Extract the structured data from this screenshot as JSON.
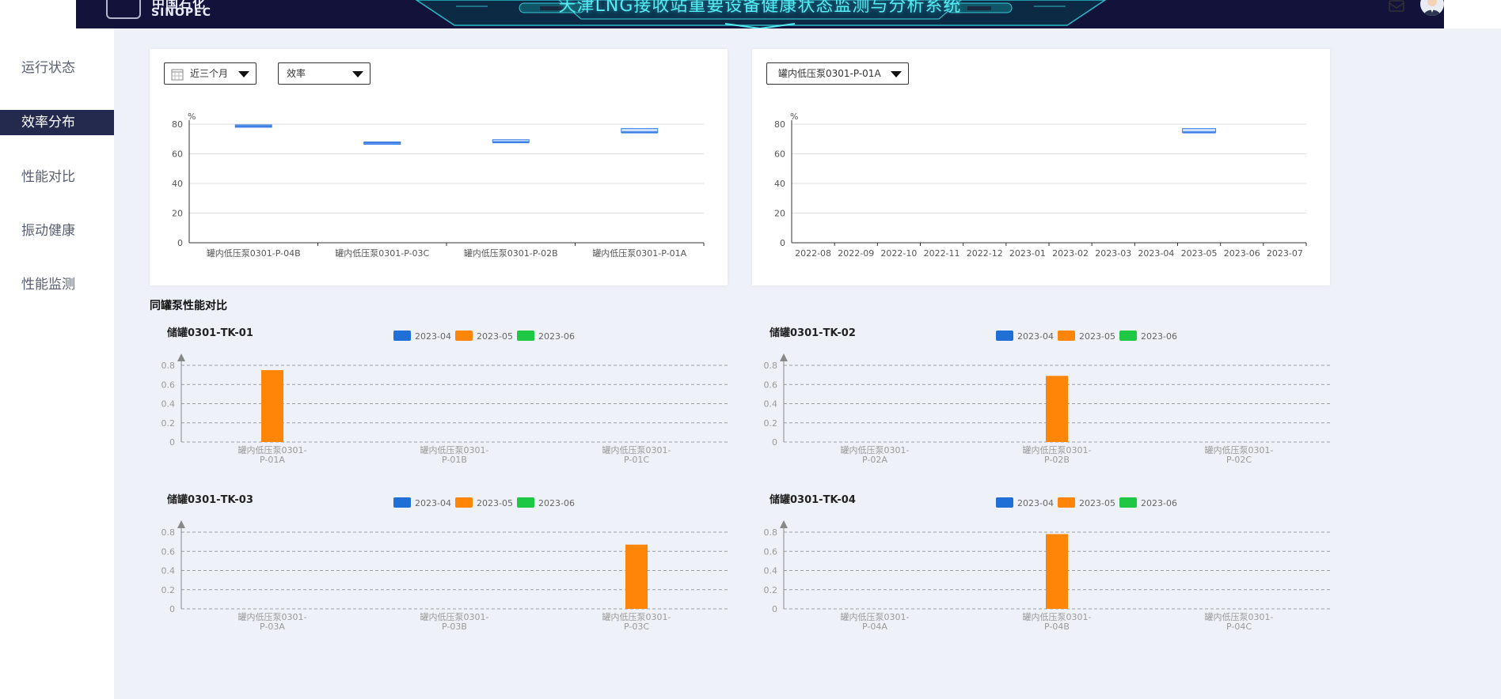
{
  "header": {
    "logo_cn": "中国石化",
    "logo_en": "SINOPEC",
    "title": "天津LNG接收站重要设备健康状态监测与分析系统",
    "accent": "#55ecf2",
    "bg": "#13123a"
  },
  "sidebar": {
    "items": [
      {
        "label": "运行状态",
        "active": false
      },
      {
        "label": "效率分布",
        "active": true
      },
      {
        "label": "性能对比",
        "active": false
      },
      {
        "label": "振动健康",
        "active": false
      },
      {
        "label": "性能监测",
        "active": false
      }
    ]
  },
  "filters": {
    "period": "近三个月",
    "metric": "效率",
    "pump": "罐内低压泵0301-P-01A"
  },
  "section": {
    "compare_title": "同罐泵性能对比"
  },
  "chart_data": [
    {
      "type": "boxplot",
      "ylabel": "%",
      "ylim": [
        0,
        80
      ],
      "yticks": [
        0,
        20,
        40,
        60,
        80
      ],
      "categories": [
        "罐内低压泵0301-P-04B",
        "罐内低压泵0301-P-03C",
        "罐内低压泵0301-P-02B",
        "罐内低压泵0301-P-01A"
      ],
      "boxes": [
        {
          "low": 78.5,
          "high": 79.5
        },
        {
          "low": 67.5,
          "high": 68.0
        },
        {
          "low": 67.8,
          "high": 69.5
        },
        {
          "low": 74.5,
          "high": 77.0
        }
      ],
      "color": "#3d7fe6"
    },
    {
      "type": "boxplot",
      "ylabel": "%",
      "ylim": [
        0,
        80
      ],
      "yticks": [
        0,
        20,
        40,
        60,
        80
      ],
      "categories": [
        "2022-08",
        "2022-09",
        "2022-10",
        "2022-11",
        "2022-12",
        "2023-01",
        "2023-02",
        "2023-03",
        "2023-04",
        "2023-05",
        "2023-06",
        "2023-07"
      ],
      "boxes": [
        null,
        null,
        null,
        null,
        null,
        null,
        null,
        null,
        null,
        {
          "low": 74.5,
          "high": 77.0
        },
        null,
        null
      ],
      "color": "#3d7fe6"
    },
    {
      "type": "bar",
      "title": "储罐0301-TK-01",
      "ylim": [
        0,
        0.8
      ],
      "yticks": [
        0,
        0.2,
        0.4,
        0.6,
        0.8
      ],
      "categories": [
        "罐内低压泵0301-P-01A",
        "罐内低压泵0301-P-01B",
        "罐内低压泵0301-P-01C"
      ],
      "series": [
        {
          "name": "2023-04",
          "color": "#1f6fd6",
          "values": [
            null,
            null,
            null
          ]
        },
        {
          "name": "2023-05",
          "color": "#ff8508",
          "values": [
            0.75,
            null,
            null
          ]
        },
        {
          "name": "2023-06",
          "color": "#1ec844",
          "values": [
            null,
            null,
            null
          ]
        }
      ]
    },
    {
      "type": "bar",
      "title": "储罐0301-TK-02",
      "ylim": [
        0,
        0.8
      ],
      "yticks": [
        0,
        0.2,
        0.4,
        0.6,
        0.8
      ],
      "categories": [
        "罐内低压泵0301-P-02A",
        "罐内低压泵0301-P-02B",
        "罐内低压泵0301-P-02C"
      ],
      "series": [
        {
          "name": "2023-04",
          "color": "#1f6fd6",
          "values": [
            null,
            null,
            null
          ]
        },
        {
          "name": "2023-05",
          "color": "#ff8508",
          "values": [
            null,
            0.69,
            null
          ]
        },
        {
          "name": "2023-06",
          "color": "#1ec844",
          "values": [
            null,
            null,
            null
          ]
        }
      ]
    },
    {
      "type": "bar",
      "title": "储罐0301-TK-03",
      "ylim": [
        0,
        0.8
      ],
      "yticks": [
        0,
        0.2,
        0.4,
        0.6,
        0.8
      ],
      "categories": [
        "罐内低压泵0301-P-03A",
        "罐内低压泵0301-P-03B",
        "罐内低压泵0301-P-03C"
      ],
      "series": [
        {
          "name": "2023-04",
          "color": "#1f6fd6",
          "values": [
            null,
            null,
            null
          ]
        },
        {
          "name": "2023-05",
          "color": "#ff8508",
          "values": [
            null,
            null,
            0.67
          ]
        },
        {
          "name": "2023-06",
          "color": "#1ec844",
          "values": [
            null,
            null,
            null
          ]
        }
      ]
    },
    {
      "type": "bar",
      "title": "储罐0301-TK-04",
      "ylim": [
        0,
        0.8
      ],
      "yticks": [
        0,
        0.2,
        0.4,
        0.6,
        0.8
      ],
      "categories": [
        "罐内低压泵0301-P-04A",
        "罐内低压泵0301-P-04B",
        "罐内低压泵0301-P-04C"
      ],
      "series": [
        {
          "name": "2023-04",
          "color": "#1f6fd6",
          "values": [
            null,
            null,
            null
          ]
        },
        {
          "name": "2023-05",
          "color": "#ff8508",
          "values": [
            null,
            0.78,
            null
          ]
        },
        {
          "name": "2023-06",
          "color": "#1ec844",
          "values": [
            null,
            null,
            null
          ]
        }
      ]
    }
  ]
}
